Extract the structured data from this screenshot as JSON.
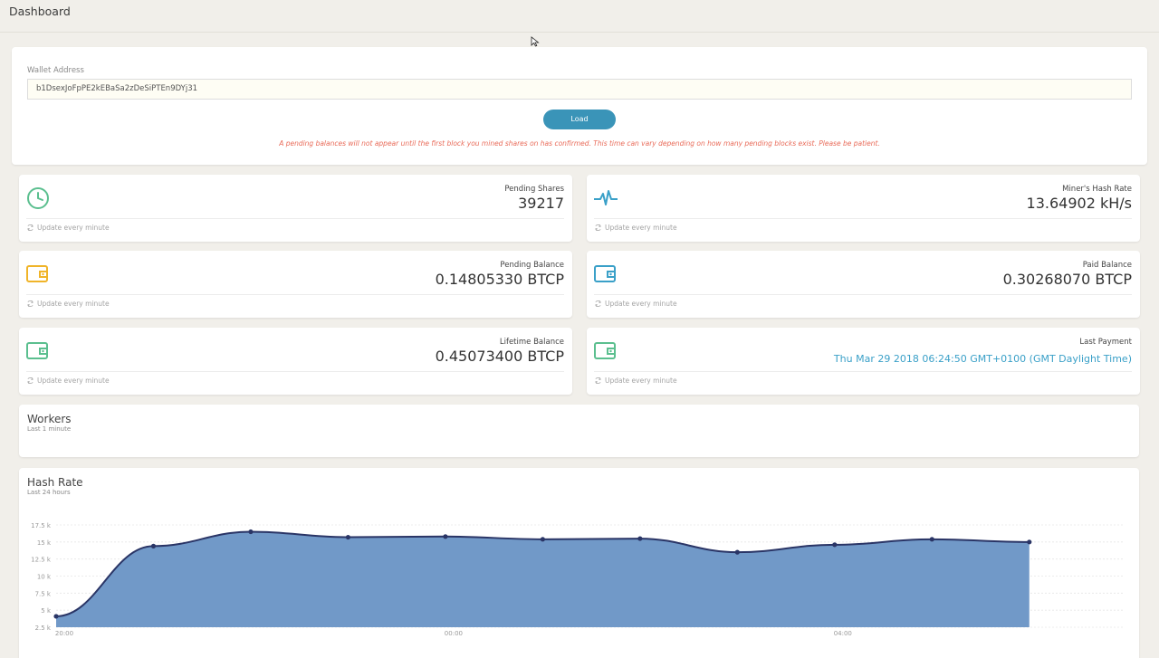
{
  "header": {
    "title": "Dashboard"
  },
  "wallet": {
    "label": "Wallet Address",
    "address": "b1DsexJoFpPE2kEBaSa2zDeSiPTEn9DYj31",
    "load_label": "Load",
    "notice": "A pending balances will not appear until the first block you mined shares on has confirmed. This time can vary depending on how many pending blocks exist. Please be patient."
  },
  "stats": [
    {
      "name": "Pending Shares",
      "value": "39217",
      "icon": "clock-icon",
      "color": "#5bbf8f",
      "foot": "Update every minute"
    },
    {
      "name": "Miner's Hash Rate",
      "value": "13.64902 kH/s",
      "icon": "pulse-icon",
      "color": "#3aa0c8",
      "foot": "Update every minute"
    },
    {
      "name": "Pending Balance",
      "value": "0.14805330 BTCP",
      "icon": "wallet-icon",
      "color": "#f0b429",
      "foot": "Update every minute"
    },
    {
      "name": "Paid Balance",
      "value": "0.30268070 BTCP",
      "icon": "wallet-icon",
      "color": "#3aa0c8",
      "foot": "Update every minute"
    },
    {
      "name": "Lifetime Balance",
      "value": "0.45073400 BTCP",
      "icon": "wallet-icon",
      "color": "#5bbf8f",
      "foot": "Update every minute"
    },
    {
      "name": "Last Payment",
      "value": "Thu Mar 29 2018 06:24:50 GMT+0100 (GMT Daylight Time)",
      "icon": "wallet-icon",
      "color": "#5bbf8f",
      "foot": "Update every minute"
    }
  ],
  "workers": {
    "title": "Workers",
    "subtitle": "Last 1 minute"
  },
  "hashrate": {
    "title": "Hash Rate",
    "subtitle": "Last 24 hours"
  },
  "chart_data": {
    "type": "area",
    "y_ticks": [
      "2.5 k",
      "5 k",
      "7.5 k",
      "10 k",
      "12.5 k",
      "15 k",
      "17.5 k"
    ],
    "y_tick_values": [
      2500,
      5000,
      7500,
      10000,
      12500,
      15000,
      17500
    ],
    "x_ticks": [
      {
        "label": "20:00",
        "x": 20
      },
      {
        "label": "00:00",
        "x": 24
      },
      {
        "label": "04:00",
        "x": 28
      }
    ],
    "x": [
      20,
      21,
      22,
      23,
      24,
      25,
      26,
      27,
      28,
      29,
      30
    ],
    "values": [
      4100,
      14400,
      16500,
      15700,
      15800,
      15400,
      15500,
      13500,
      14600,
      15400,
      15000
    ],
    "ylim": [
      2500,
      17500
    ],
    "xlim": [
      20,
      30.97
    ],
    "fill_color": "#7199c8",
    "line_color": "#2a3566",
    "grid": true
  }
}
